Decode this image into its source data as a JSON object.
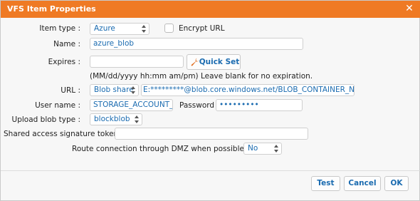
{
  "window": {
    "title": "VFS Item Properties"
  },
  "form": {
    "item_type": {
      "label": "Item type :",
      "value": "Azure"
    },
    "encrypt_url": {
      "label": "Encrypt URL",
      "checked": false
    },
    "name": {
      "label": "Name :",
      "value": "azure_blob"
    },
    "expires": {
      "label": "Expires :",
      "value": "",
      "quick_set_label": "Quick Set",
      "hint": "(MM/dd/yyyy hh:mm am/pm) Leave blank for no expiration."
    },
    "url": {
      "label": "URL :",
      "scheme": "Blob share",
      "value": "E:*********@blob.core.windows.net/BLOB_CONTAINER_NAME/"
    },
    "user_name": {
      "label": "User name :",
      "value": "STORAGE_ACCOUNT_NA"
    },
    "password": {
      "label": "Password :",
      "value": "•••••••••"
    },
    "upload_blob_type": {
      "label": "Upload blob type :",
      "value": "blockblob"
    },
    "sas_token": {
      "label": "Shared access signature token :",
      "value": ""
    },
    "dmz": {
      "label": "Route connection through DMZ when possible :",
      "value": "No"
    }
  },
  "buttons": {
    "test": "Test",
    "cancel": "Cancel",
    "ok": "OK"
  },
  "colors": {
    "title_bar": "#ef7a24",
    "accent_text": "#1a6bb0"
  },
  "icons": {
    "close": "close-icon",
    "quick_set": "wrench-icon"
  }
}
